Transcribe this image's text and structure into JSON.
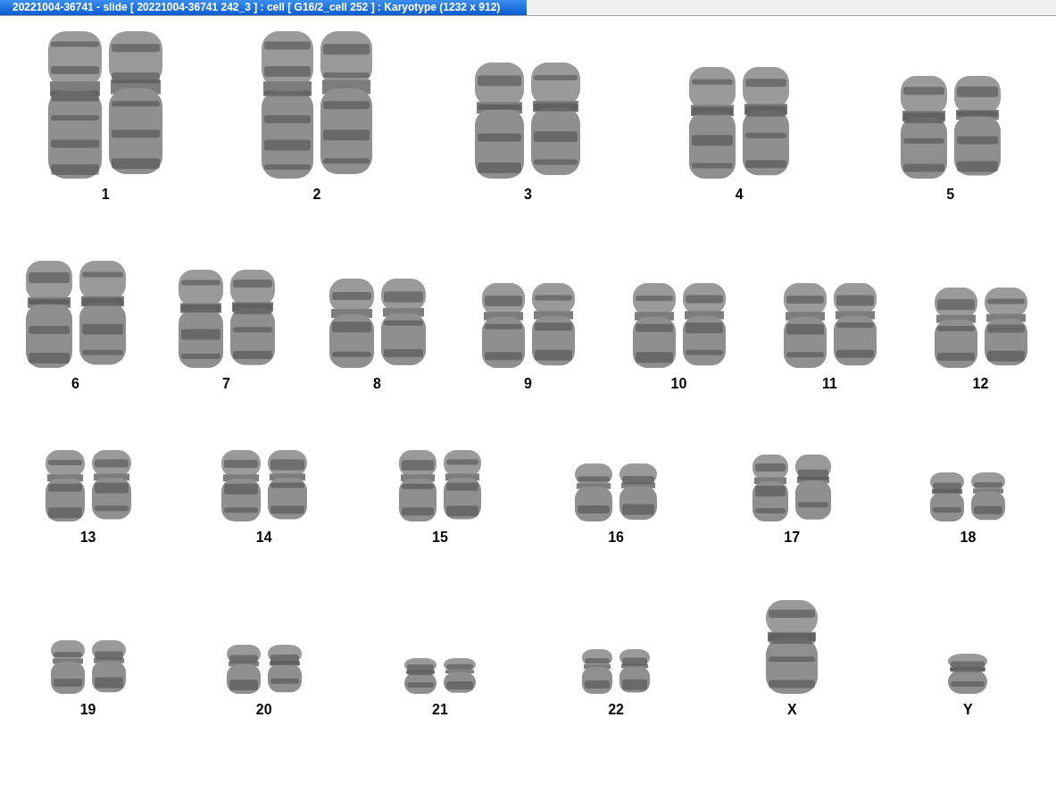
{
  "title_bar": {
    "title": "20221004-36741 - slide [ 20221004-36741 242_3 ] : cell [ G16/2_cell 252 ] : Karyotype  (1232 x 912)"
  },
  "karyotype": {
    "rows": [
      {
        "pairs": [
          {
            "label": "1"
          },
          {
            "label": "2"
          },
          {
            "label": "3"
          },
          {
            "label": "4"
          },
          {
            "label": "5"
          }
        ]
      },
      {
        "pairs": [
          {
            "label": "6"
          },
          {
            "label": "7"
          },
          {
            "label": "8"
          },
          {
            "label": "9"
          },
          {
            "label": "10"
          },
          {
            "label": "11"
          },
          {
            "label": "12"
          }
        ]
      },
      {
        "pairs": [
          {
            "label": "13"
          },
          {
            "label": "14"
          },
          {
            "label": "15"
          },
          {
            "label": "16"
          },
          {
            "label": "17"
          },
          {
            "label": "18"
          }
        ]
      },
      {
        "pairs": [
          {
            "label": "19"
          },
          {
            "label": "20"
          },
          {
            "label": "21"
          },
          {
            "label": "22"
          },
          {
            "label": "X",
            "kind": "single"
          },
          {
            "label": "Y",
            "kind": "single"
          }
        ]
      }
    ]
  }
}
